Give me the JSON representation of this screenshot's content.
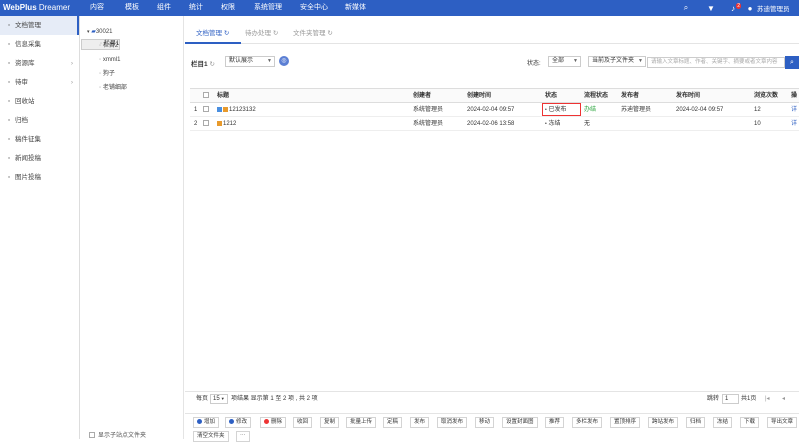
{
  "header": {
    "logo_bold": "WebPlus",
    "logo_rest": " Dreamer",
    "nav": [
      "内容",
      "模板",
      "组件",
      "统计",
      "权限",
      "系统管理",
      "安全中心",
      "新媒体"
    ],
    "badge": "2",
    "user": "苏迪管理员",
    "icons": [
      "search-icon",
      "shirt-icon",
      "bell-icon",
      "user-icon"
    ]
  },
  "leftmenu": [
    {
      "label": "文档管理",
      "icon": "document-icon"
    },
    {
      "label": "信息采集",
      "icon": "collect-icon"
    },
    {
      "label": "资源库",
      "icon": "folder-icon",
      "arrow": "›"
    },
    {
      "label": "待审",
      "icon": "audit-icon",
      "arrow": "›"
    },
    {
      "label": "回收站",
      "icon": "trash-icon"
    },
    {
      "label": "归档",
      "icon": "archive-icon"
    },
    {
      "label": "稿件征集",
      "icon": "collect-manuscript-icon"
    },
    {
      "label": "新闻投稿",
      "icon": "news-icon"
    },
    {
      "label": "图片投稿",
      "icon": "image-icon"
    }
  ],
  "tree": {
    "root": "30021",
    "nodes": [
      "栏目1",
      "栏目2",
      "xmml1",
      "狗子",
      "老铺细部"
    ],
    "footer": "显示子站点文件夹"
  },
  "tabs": [
    "文档管理",
    "待办处理",
    "文件夹管理"
  ],
  "toolbar": {
    "column_label": "栏目1",
    "view_select": "默认展示",
    "status_label": "状态:",
    "status_select": "全部",
    "scope_select": "当前及子文件夹",
    "search_placeholder": "请输入文章标题、作者、关键字、摘要或者文章内容"
  },
  "table": {
    "headers": [
      "标题",
      "创建者",
      "创建时间",
      "状态",
      "流程状态",
      "发布者",
      "发布时间",
      "浏览次数",
      "操"
    ],
    "rows": [
      [
        "1",
        "12123132",
        "系统管理员",
        "2024-02-04 09:57",
        "已发布",
        "办结",
        "苏迪管理员",
        "2024-02-04 09:57",
        "12",
        "详"
      ],
      [
        "2",
        "1212",
        "系统管理员",
        "2024-02-06 13:58",
        "冻结",
        "无",
        "",
        "",
        "10",
        "详"
      ]
    ]
  },
  "pager": {
    "per_page_label": "每页",
    "per_page": "15",
    "summary": "项结果 显示第 1 至 2 项 , 共 2 项",
    "jump_label": "跳转",
    "page": "1",
    "total_pages": "共1页"
  },
  "actions": [
    "增加",
    "修改",
    "删除",
    "收回",
    "复制",
    "批量上传",
    "定稿",
    "发布",
    "取消发布",
    "移动",
    "设置封面图",
    "推荐",
    "多栏发布",
    "置顶排序",
    "跨站发布",
    "归档",
    "冻结",
    "下载",
    "导出文章",
    "清空文件夹",
    "⋯"
  ],
  "colors": {
    "primary": "#2d5fc3",
    "green": "#27a33a",
    "highlight": "#e33333"
  }
}
